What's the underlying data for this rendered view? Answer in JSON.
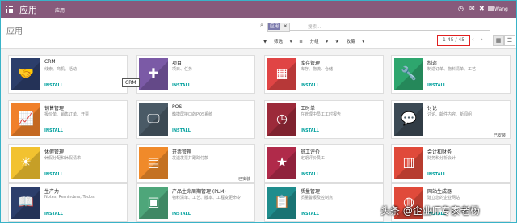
{
  "nav": {
    "app_title": "应用",
    "menu": "应用",
    "user": "Wang"
  },
  "control": {
    "breadcrumb": "应用",
    "search_tag": "应用",
    "search_facet_label": "",
    "search_placeholder": "搜索...",
    "filters": "筛选",
    "group_by": "分组",
    "favorites": "收藏",
    "pager": "1-45 / 45"
  },
  "tooltip": "CRM",
  "apps": [
    {
      "name": "CRM",
      "summary": "线索、商机、活动",
      "action": "INSTALL",
      "status": "",
      "color": "#2c3e6b",
      "icon": "handshake-icon"
    },
    {
      "name": "项目",
      "summary": "项目、任务",
      "action": "INSTALL",
      "status": "",
      "color": "#7b5aa6",
      "icon": "puzzle-icon"
    },
    {
      "name": "库存管理",
      "summary": "库存、物流、仓储",
      "action": "INSTALL",
      "status": "",
      "color": "#e04545",
      "icon": "boxes-icon"
    },
    {
      "name": "制造",
      "summary": "制造订单、物料清单、工艺",
      "action": "INSTALL",
      "status": "",
      "color": "#2ea66e",
      "icon": "wrench-icon"
    },
    {
      "name": "销售管理",
      "summary": "报价单、销售订单、开票",
      "action": "INSTALL",
      "status": "",
      "color": "#f0802a",
      "icon": "chart-icon"
    },
    {
      "name": "POS",
      "summary": "触摸屏接口的POS系统",
      "action": "INSTALL",
      "status": "",
      "color": "#4a5a66",
      "icon": "monitor-icon"
    },
    {
      "name": "工时单",
      "summary": "在管理中员工工时报告",
      "action": "INSTALL",
      "status": "",
      "color": "#9c2a3a",
      "icon": "clock-icon"
    },
    {
      "name": "讨论",
      "summary": "讨论、邮件内容、新闻组",
      "action": "",
      "status": "已安装",
      "color": "#3c4a55",
      "icon": "chat-icon"
    },
    {
      "name": "休假管理",
      "summary": "休假分配和休假请求",
      "action": "INSTALL",
      "status": "",
      "color": "#f2c230",
      "icon": "sun-icon"
    },
    {
      "name": "开票管理",
      "summary": "发送发票并跟踪付款",
      "action": "",
      "status": "已安装",
      "color": "#f08a2a",
      "icon": "invoice-icon"
    },
    {
      "name": "员工评价",
      "summary": "定期评价员工",
      "action": "INSTALL",
      "status": "",
      "color": "#b02a4a",
      "icon": "star-icon"
    },
    {
      "name": "会计和财务",
      "summary": "财务和分析会计",
      "action": "INSTALL",
      "status": "",
      "color": "#e04a3a",
      "icon": "document-icon"
    },
    {
      "name": "生产力",
      "summary": "Notes, Reminders, Todos",
      "action": "INSTALL",
      "status": "",
      "color": "#2c3e6b",
      "icon": "book-icon"
    },
    {
      "name": "产品生命周期管理 (PLM)",
      "summary": "物料清单、工艺、版本、工程变更命令",
      "action": "INSTALL",
      "status": "",
      "color": "#4ea67a",
      "icon": "package-icon"
    },
    {
      "name": "质量管理",
      "summary": "质量警报及控制点",
      "action": "INSTALL",
      "status": "",
      "color": "#1f8d8d",
      "icon": "clipboard-icon"
    },
    {
      "name": "网站生成器",
      "summary": "建立您的企业网站",
      "action": "INSTALL",
      "status": "",
      "color": "#e04a3a",
      "icon": "globe-icon"
    }
  ],
  "watermark": "头条 @企业IT专家老杨"
}
